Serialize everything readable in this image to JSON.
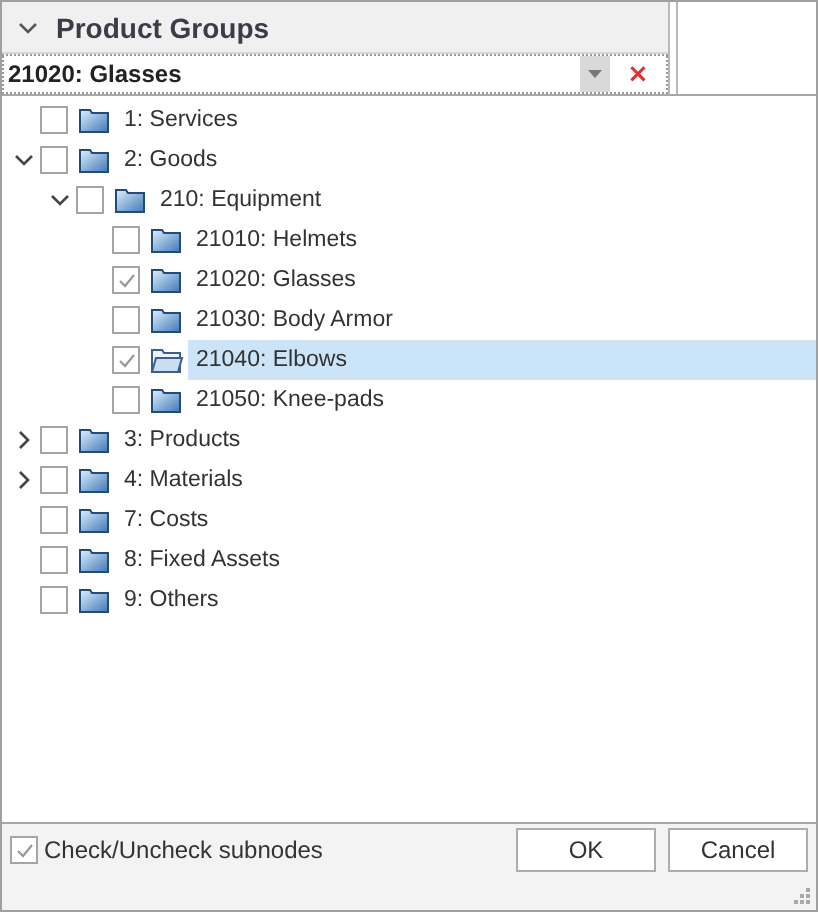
{
  "header": {
    "title": "Product Groups",
    "expanded": true
  },
  "combo": {
    "value": "21020: Glasses",
    "clear": "×"
  },
  "tree": [
    {
      "label": "1: Services",
      "checked": false,
      "selected": false
    },
    {
      "label": "2: Goods",
      "checked": false,
      "selected": false,
      "expanded": true,
      "children": [
        {
          "label": "210: Equipment",
          "checked": false,
          "selected": false,
          "expanded": true,
          "children": [
            {
              "label": "21010: Helmets",
              "checked": false,
              "selected": false
            },
            {
              "label": "21020: Glasses",
              "checked": true,
              "selected": false
            },
            {
              "label": "21030: Body Armor",
              "checked": false,
              "selected": false
            },
            {
              "label": "21040: Elbows",
              "checked": true,
              "selected": true
            },
            {
              "label": "21050: Knee-pads",
              "checked": false,
              "selected": false
            }
          ]
        }
      ]
    },
    {
      "label": "3: Products",
      "checked": false,
      "selected": false,
      "expanded": false
    },
    {
      "label": "4: Materials",
      "checked": false,
      "selected": false,
      "expanded": false
    },
    {
      "label": "7: Costs",
      "checked": false,
      "selected": false
    },
    {
      "label": "8: Fixed Assets",
      "checked": false,
      "selected": false
    },
    {
      "label": "9: Others",
      "checked": false,
      "selected": false
    }
  ],
  "subnodes": {
    "label": "Check/Uncheck subnodes",
    "checked": true
  },
  "buttons": [
    {
      "label": "OK"
    },
    {
      "label": "Cancel"
    }
  ]
}
